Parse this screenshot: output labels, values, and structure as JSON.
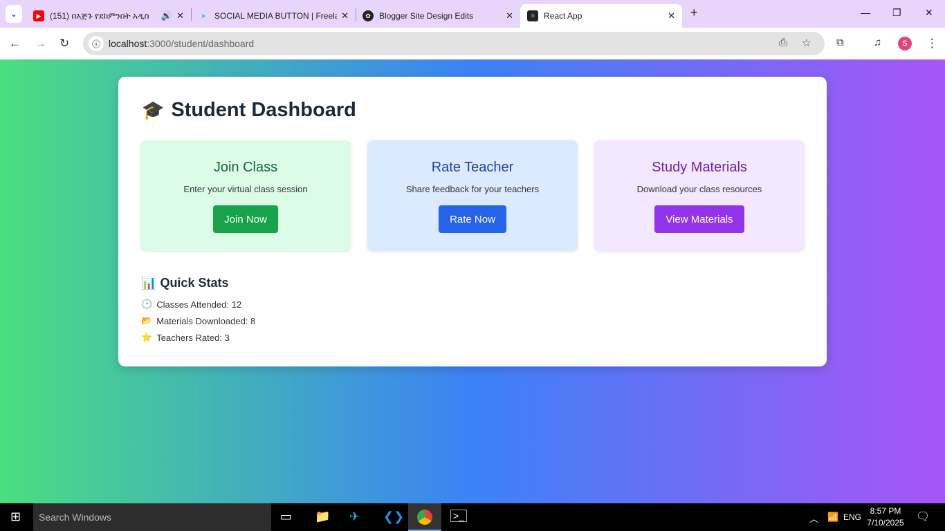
{
  "browser": {
    "tabs": [
      {
        "title": "(151) በእጅጉ የደከምንበት አዲስ",
        "icon": "youtube-icon",
        "audio": true
      },
      {
        "title": "SOCIAL MEDIA BUTTON | Freela",
        "icon": "freelancer-icon"
      },
      {
        "title": "Blogger Site Design Edits",
        "icon": "chatgpt-icon"
      },
      {
        "title": "React App",
        "icon": "react-icon",
        "active": true
      }
    ],
    "url_host": "localhost",
    "url_path": ":3000/student/dashboard",
    "profile_initial": "S"
  },
  "dashboard": {
    "title": "Student Dashboard",
    "title_icon": "🎓",
    "cards": [
      {
        "title": "Join Class",
        "description": "Enter your virtual class session",
        "button": "Join Now",
        "color": "#16a34a",
        "bg": "#dcfce7",
        "title_color": "#166534"
      },
      {
        "title": "Rate Teacher",
        "description": "Share feedback for your teachers",
        "button": "Rate Now",
        "color": "#2563eb",
        "bg": "#dbeafe",
        "title_color": "#1e40af"
      },
      {
        "title": "Study Materials",
        "description": "Download your class resources",
        "button": "View Materials",
        "color": "#9333ea",
        "bg": "#f3e8ff",
        "title_color": "#6b21a8"
      }
    ],
    "quick_stats": {
      "title": "Quick Stats",
      "icon": "📊",
      "items": [
        {
          "icon": "🕒",
          "text": "Classes Attended: 12"
        },
        {
          "icon": "📂",
          "text": "Materials Downloaded: 8"
        },
        {
          "icon": "⭐",
          "text": "Teachers Rated: 3"
        }
      ]
    }
  },
  "taskbar": {
    "search_placeholder": "Search Windows",
    "time": "8:57 PM",
    "date": "7/10/2025",
    "language": "ENG"
  }
}
